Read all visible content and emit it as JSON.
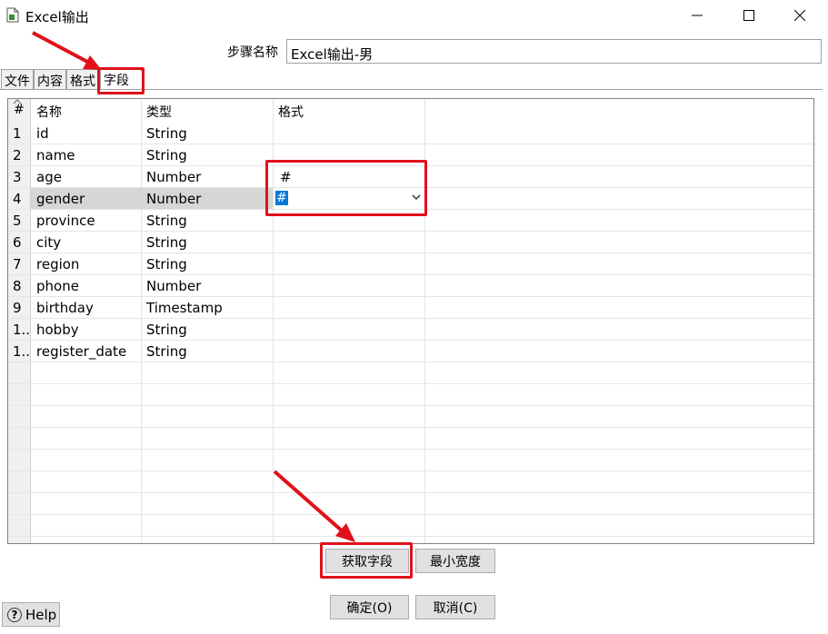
{
  "window": {
    "title": "Excel输出"
  },
  "step": {
    "label": "步骤名称",
    "value": "Excel输出-男"
  },
  "tabs": [
    {
      "label": "文件"
    },
    {
      "label": "内容"
    },
    {
      "label": "格式"
    },
    {
      "label": "字段"
    }
  ],
  "table": {
    "headers": {
      "num": "#",
      "name": "名称",
      "type": "类型",
      "format": "格式"
    },
    "rows": [
      {
        "num": "1",
        "name": "id",
        "type": "String",
        "format": ""
      },
      {
        "num": "2",
        "name": "name",
        "type": "String",
        "format": ""
      },
      {
        "num": "3",
        "name": "age",
        "type": "Number",
        "format": "#"
      },
      {
        "num": "4",
        "name": "gender",
        "type": "Number",
        "format": "#"
      },
      {
        "num": "5",
        "name": "province",
        "type": "String",
        "format": ""
      },
      {
        "num": "6",
        "name": "city",
        "type": "String",
        "format": ""
      },
      {
        "num": "7",
        "name": "region",
        "type": "String",
        "format": ""
      },
      {
        "num": "8",
        "name": "phone",
        "type": "Number",
        "format": ""
      },
      {
        "num": "9",
        "name": "birthday",
        "type": "Timestamp",
        "format": ""
      },
      {
        "num": "1..",
        "name": "hobby",
        "type": "String",
        "format": ""
      },
      {
        "num": "1..",
        "name": "register_date",
        "type": "String",
        "format": ""
      }
    ],
    "selected_row": 4
  },
  "buttons": {
    "get_fields": "获取字段",
    "min_width": "最小宽度",
    "ok": "确定(O)",
    "cancel": "取消(C)",
    "help": "Help"
  },
  "colors": {
    "highlight": "#e0111b",
    "selection": "#0078d7"
  }
}
